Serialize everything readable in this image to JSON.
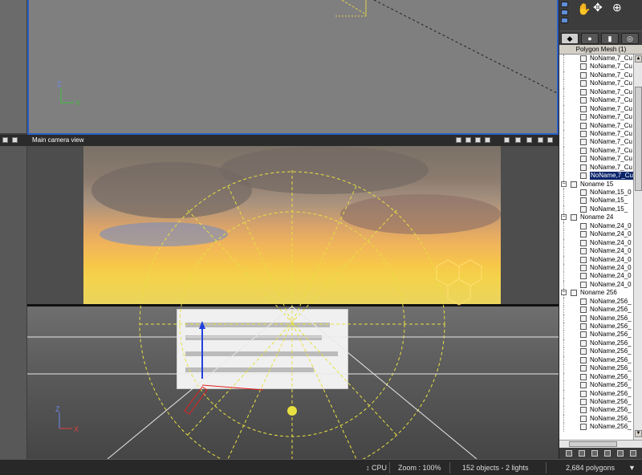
{
  "top_view": {
    "axis_z": "Z",
    "axis_y": "Y"
  },
  "camera_view": {
    "title": "Main camera view",
    "axis_z": "Z",
    "axis_x": "X"
  },
  "panel": {
    "tabs": [
      "objects",
      "materials",
      "textures",
      "render"
    ],
    "header": "Polygon Mesh (1)",
    "tree": [
      {
        "type": "child",
        "label": "NoName,7_Cu"
      },
      {
        "type": "child",
        "label": "NoName,7_Cu"
      },
      {
        "type": "child",
        "label": "NoName,7_Cu"
      },
      {
        "type": "child",
        "label": "NoName,7_Cu"
      },
      {
        "type": "child",
        "label": "NoName,7_Cu"
      },
      {
        "type": "child",
        "label": "NoName,7_Cu"
      },
      {
        "type": "child",
        "label": "NoName,7_Cu"
      },
      {
        "type": "child",
        "label": "NoName,7_Cu"
      },
      {
        "type": "child",
        "label": "NoName,7_Cu"
      },
      {
        "type": "child",
        "label": "NoName,7_Cu"
      },
      {
        "type": "child",
        "label": "NoName,7_Cu"
      },
      {
        "type": "child",
        "label": "NoName,7_Cu"
      },
      {
        "type": "child",
        "label": "NoName,7_Cu"
      },
      {
        "type": "child",
        "label": "NoName,7_Cu"
      },
      {
        "type": "child",
        "label": "NoName,7_Cu",
        "selected": true
      },
      {
        "type": "group",
        "label": "Noname 15"
      },
      {
        "type": "child",
        "label": "NoName,15_0"
      },
      {
        "type": "child",
        "label": "NoName,15_"
      },
      {
        "type": "child",
        "label": "NoName,15_"
      },
      {
        "type": "group",
        "label": "Noname 24"
      },
      {
        "type": "child",
        "label": "NoName,24_0"
      },
      {
        "type": "child",
        "label": "NoName,24_0"
      },
      {
        "type": "child",
        "label": "NoName,24_0"
      },
      {
        "type": "child",
        "label": "NoName,24_0"
      },
      {
        "type": "child",
        "label": "NoName,24_0"
      },
      {
        "type": "child",
        "label": "NoName,24_0"
      },
      {
        "type": "child",
        "label": "NoName,24_0"
      },
      {
        "type": "child",
        "label": "NoName,24_0"
      },
      {
        "type": "group",
        "label": "Noname 256"
      },
      {
        "type": "child",
        "label": "NoName,256_"
      },
      {
        "type": "child",
        "label": "NoName,256_"
      },
      {
        "type": "child",
        "label": "NoName,256_"
      },
      {
        "type": "child",
        "label": "NoName,256_"
      },
      {
        "type": "child",
        "label": "NoName,256_"
      },
      {
        "type": "child",
        "label": "NoName,256_"
      },
      {
        "type": "child",
        "label": "NoName,256_"
      },
      {
        "type": "child",
        "label": "NoName,256_"
      },
      {
        "type": "child",
        "label": "NoName,256_"
      },
      {
        "type": "child",
        "label": "NoName,256_"
      },
      {
        "type": "child",
        "label": "NoName,256_"
      },
      {
        "type": "child",
        "label": "NoName,256_"
      },
      {
        "type": "child",
        "label": "NoName,256_"
      },
      {
        "type": "child",
        "label": "NoName,256_"
      },
      {
        "type": "child",
        "label": "NoName,256_"
      },
      {
        "type": "child",
        "label": "NoName,256_"
      }
    ]
  },
  "status": {
    "cpu": "CPU",
    "zoom": "Zoom : 100%",
    "objects": "152 objects - 2 lights",
    "polygons": "2,684 polygons"
  },
  "colors": {
    "accent": "#2860c8",
    "selection": "#0a246a",
    "guide": "#e8e040"
  }
}
